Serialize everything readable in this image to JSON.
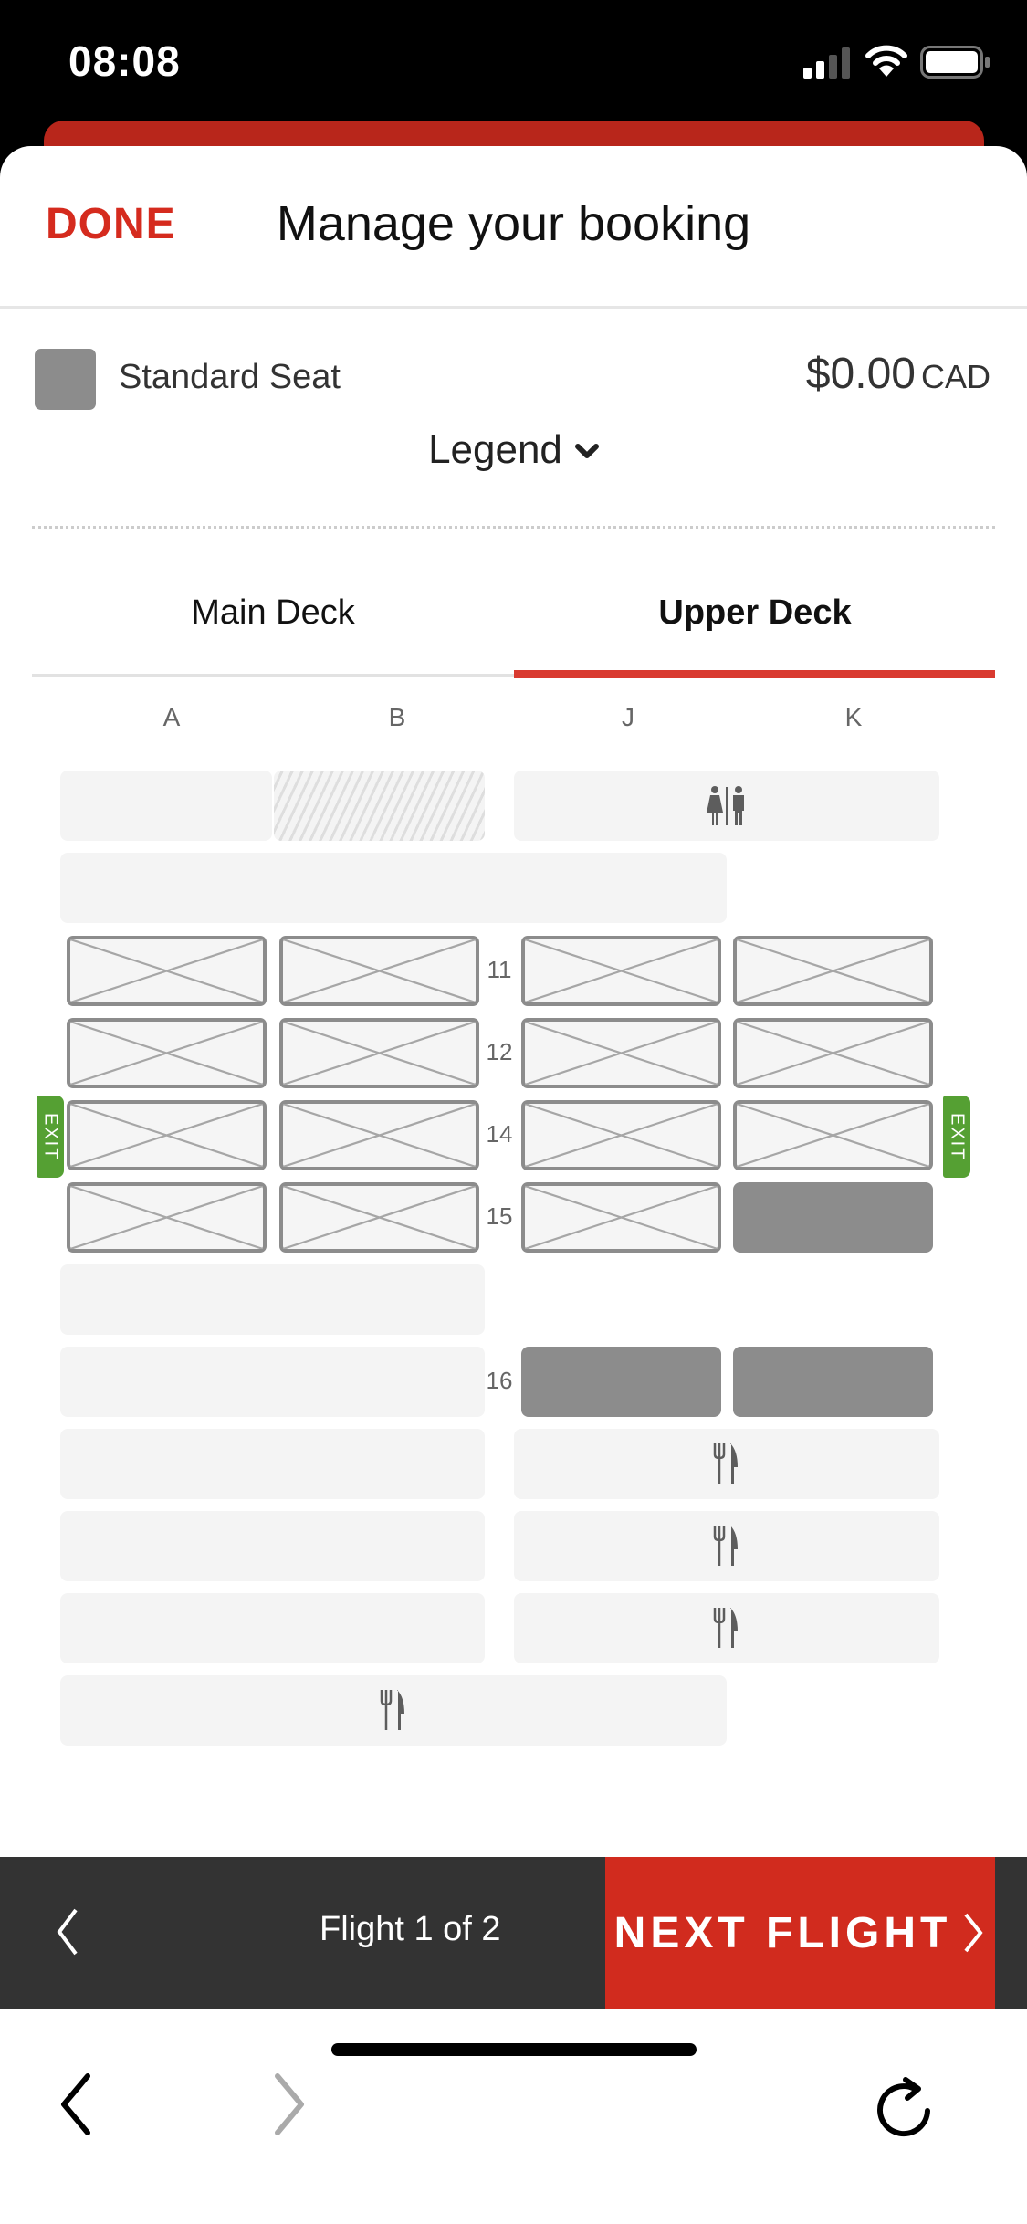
{
  "status_bar": {
    "time": "08:08",
    "icons": [
      "signal-icon",
      "wifi-icon",
      "battery-icon"
    ]
  },
  "header": {
    "done_label": "DONE",
    "title": "Manage your booking"
  },
  "legend": {
    "seat_type": "Standard Seat",
    "price": "$0.00",
    "currency": "CAD",
    "swatch_color": "#8c8c8c",
    "toggle_label": "Legend"
  },
  "deck_tabs": [
    {
      "label": "Main Deck",
      "active": false
    },
    {
      "label": "Upper Deck",
      "active": true
    }
  ],
  "accent_color": "#d52b1e",
  "columns": [
    "A",
    "B",
    "J",
    "K"
  ],
  "seat_map": {
    "rows": [
      {
        "number": "11",
        "seats": {
          "A": "unavailable",
          "B": "unavailable",
          "J": "unavailable",
          "K": "unavailable"
        }
      },
      {
        "number": "12",
        "seats": {
          "A": "unavailable",
          "B": "unavailable",
          "J": "unavailable",
          "K": "unavailable"
        }
      },
      {
        "number": "14",
        "seats": {
          "A": "unavailable",
          "B": "unavailable",
          "J": "unavailable",
          "K": "unavailable"
        },
        "exit_row": true
      },
      {
        "number": "15",
        "seats": {
          "A": "unavailable",
          "B": "unavailable",
          "J": "unavailable",
          "K": "available"
        }
      },
      {
        "number": "16",
        "seats": {
          "J": "available",
          "K": "available"
        }
      }
    ],
    "exit_label": "EXIT",
    "facilities": [
      "lavatory-icon",
      "galley-icon",
      "galley-icon",
      "galley-icon",
      "galley-icon"
    ]
  },
  "flight_nav": {
    "count_label": "Flight 1 of 2",
    "next_label": "NEXT FLIGHT"
  },
  "browser_toolbar": {
    "buttons": [
      "back",
      "forward",
      "reload"
    ]
  }
}
